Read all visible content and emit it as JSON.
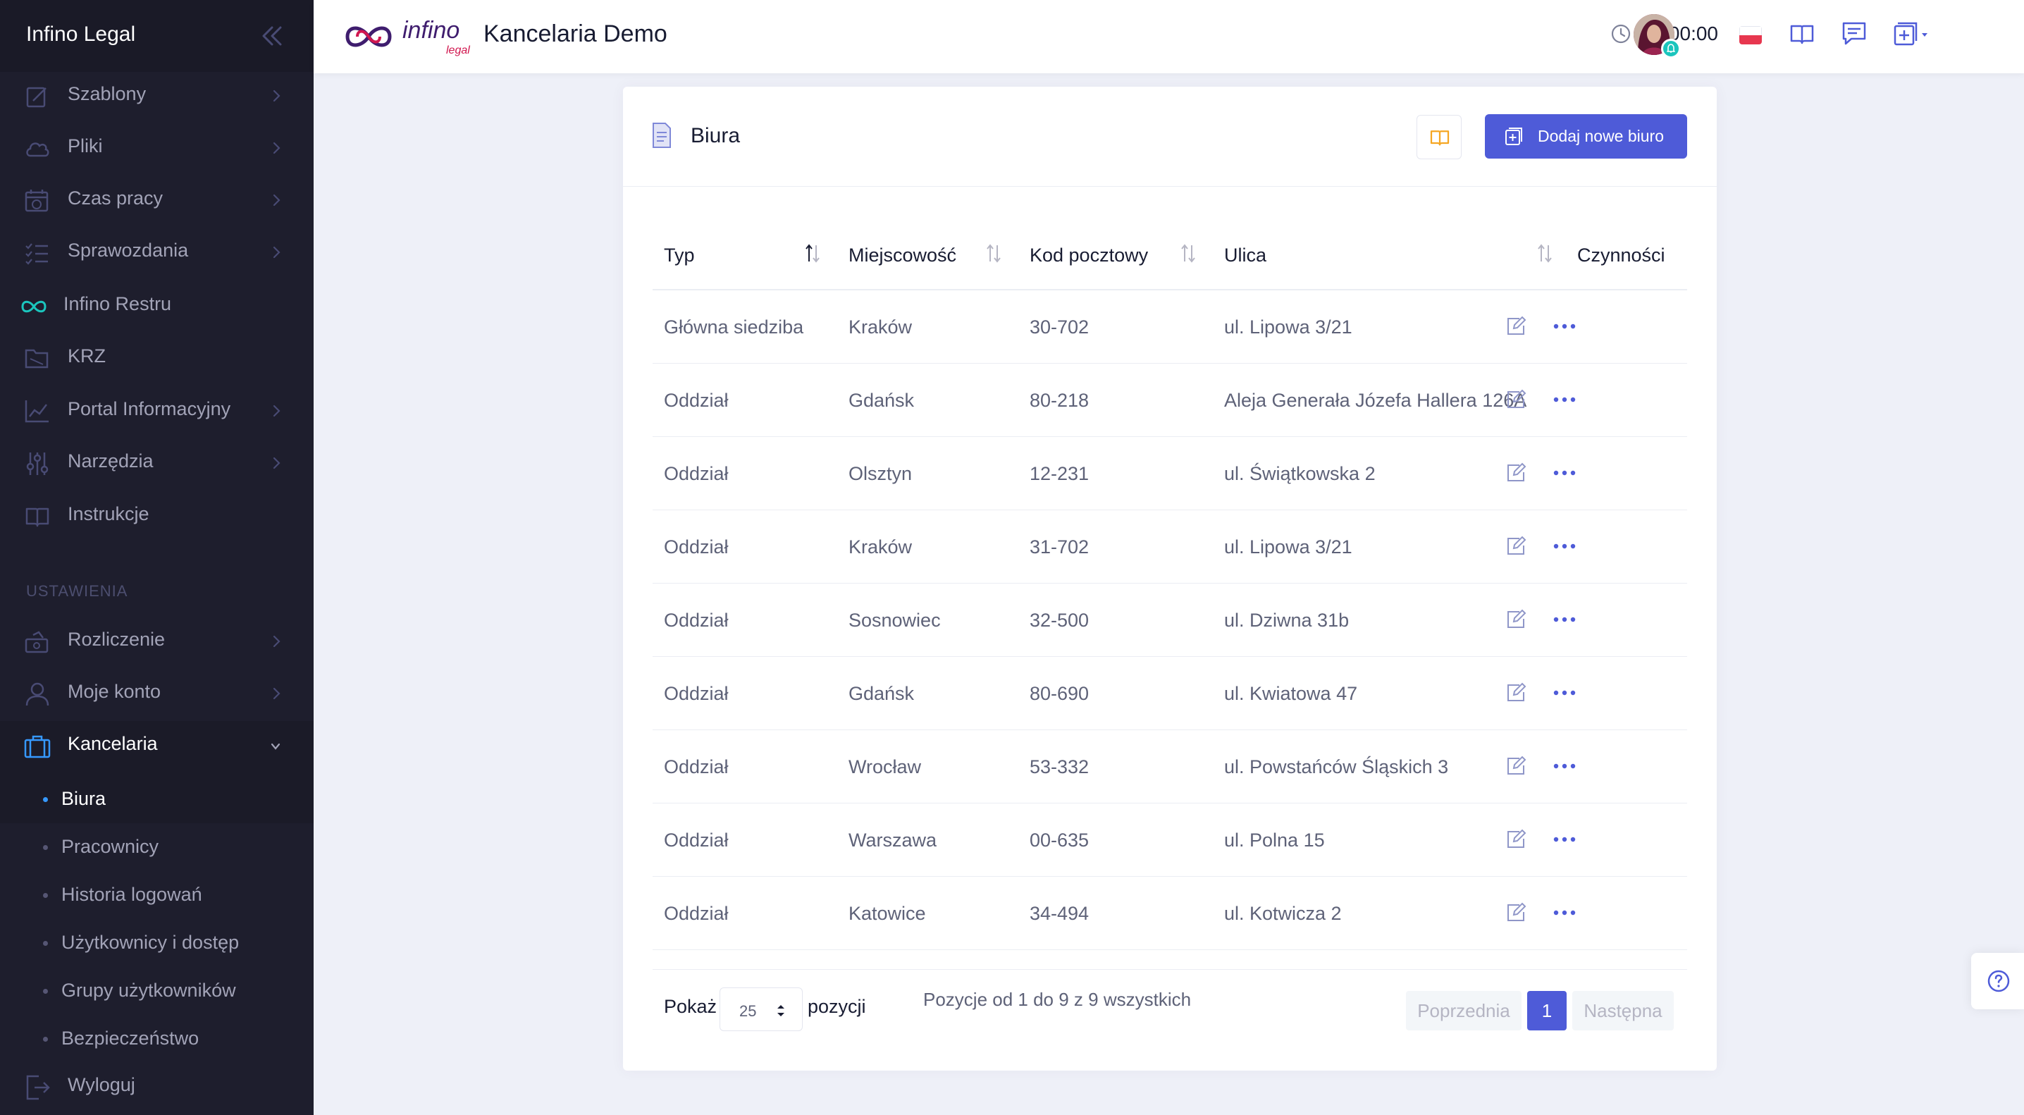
{
  "sidebar": {
    "brand": "Infino Legal",
    "items": [
      {
        "label": "Szablony",
        "icon": "template-icon"
      },
      {
        "label": "Pliki",
        "icon": "cloud-icon"
      },
      {
        "label": "Czas pracy",
        "icon": "calendar-clock-icon"
      },
      {
        "label": "Sprawozdania",
        "icon": "list-check-icon"
      },
      {
        "label": "Infino Restru",
        "icon": "infinity-icon"
      },
      {
        "label": "KRZ",
        "icon": "folder-icon"
      },
      {
        "label": "Portal Informacyjny",
        "icon": "chart-icon"
      },
      {
        "label": "Narzędzia",
        "icon": "sliders-icon"
      },
      {
        "label": "Instrukcje",
        "icon": "book-icon"
      }
    ],
    "section": "USTAWIENIA",
    "settings": [
      {
        "label": "Rozliczenie",
        "icon": "money-icon"
      },
      {
        "label": "Moje konto",
        "icon": "user-icon"
      },
      {
        "label": "Kancelaria",
        "icon": "briefcase-icon"
      }
    ],
    "subitems": [
      {
        "label": "Biura"
      },
      {
        "label": "Pracownicy"
      },
      {
        "label": "Historia logowań"
      },
      {
        "label": "Użytkownicy i dostęp"
      },
      {
        "label": "Grupy użytkowników"
      },
      {
        "label": "Bezpieczeństwo"
      }
    ],
    "logout": "Wyloguj"
  },
  "header": {
    "logo_text": "infino",
    "logo_sub": "legal",
    "title": "Kancelaria Demo",
    "timer": "00:00:00"
  },
  "page": {
    "title": "Biura",
    "add_button": "Dodaj nowe biuro"
  },
  "table": {
    "columns": [
      "Typ",
      "Miejscowość",
      "Kod pocztowy",
      "Ulica",
      "Czynności"
    ],
    "rows": [
      [
        "Główna siedziba",
        "Kraków",
        "30-702",
        "ul. Lipowa 3/21"
      ],
      [
        "Oddział",
        "Gdańsk",
        "80-218",
        "Aleja Generała Józefa Hallera 126A"
      ],
      [
        "Oddział",
        "Olsztyn",
        "12-231",
        "ul. Świątkowska 2"
      ],
      [
        "Oddział",
        "Kraków",
        "31-702",
        "ul. Lipowa 3/21"
      ],
      [
        "Oddział",
        "Sosnowiec",
        "32-500",
        "ul. Dziwna 31b"
      ],
      [
        "Oddział",
        "Gdańsk",
        "80-690",
        "ul. Kwiatowa 47"
      ],
      [
        "Oddział",
        "Wrocław",
        "53-332",
        "ul. Powstańców Śląskich 3"
      ],
      [
        "Oddział",
        "Warszawa",
        "00-635",
        "ul. Polna 15"
      ],
      [
        "Oddział",
        "Katowice",
        "34-494",
        "ul. Kotwicza 2"
      ]
    ]
  },
  "footer": {
    "show_label": "Pokaż",
    "page_size": "25",
    "positions_label": "pozycji",
    "info": "Pozycje od 1 do 9 z 9 wszystkich",
    "prev": "Poprzednia",
    "current_page": "1",
    "next": "Następna"
  },
  "colors": {
    "sidebar_bg": "#1e1e2d",
    "primary": "#4e5bd8",
    "brand_purple": "#3f1d6e",
    "brand_red": "#d1174f",
    "accent_blue": "#3699ff"
  }
}
